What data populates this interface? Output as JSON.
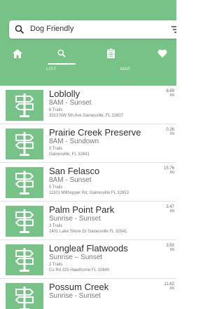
{
  "search": {
    "value": "Dog Friendly"
  },
  "tabs": [
    {
      "icon": "home-icon"
    },
    {
      "icon": "search-icon"
    },
    {
      "icon": "clipboard-icon"
    },
    {
      "icon": "heart-icon"
    }
  ],
  "segments": {
    "list_label": "LIST",
    "map_label": "MAP"
  },
  "parks": [
    {
      "name": "Loblolly",
      "hours": "8AM - Sunset",
      "trails": "8 Trails",
      "address": "3313 NW 5th Ave Gainesville, FL 32607",
      "distance": "8.69",
      "unit": "mi"
    },
    {
      "name": "Prairie Creek Preserve",
      "hours": "8AM - Sundown",
      "trails": "5 Trails",
      "address": "Gainesville, FL 32641",
      "distance": "0.26",
      "unit": "mi"
    },
    {
      "name": "San Felasco",
      "hours": "8AM - Sunset",
      "trails": "5 Trails",
      "address": "11101 Millhopper Rd, Gainesville FL 32653",
      "distance": "15.76",
      "unit": "mi"
    },
    {
      "name": "Palm Point Park",
      "hours": "Sunrise - Sunset",
      "trails": "3 Trails",
      "address": "2401 Lake Shore Dr Gainesville FL 32641",
      "distance": "3.47",
      "unit": "mi"
    },
    {
      "name": "Longleaf Flatwoods",
      "hours": "Sunrise – Sunset",
      "trails": "2 Trails",
      "address": "Co Rd 325 Hawthorne FL 32640",
      "distance": "3.50",
      "unit": "mi"
    },
    {
      "name": "Possum Creek",
      "hours": "Sunrise - Sunset",
      "trails": "",
      "address": "",
      "distance": "11.62",
      "unit": "mi"
    }
  ]
}
